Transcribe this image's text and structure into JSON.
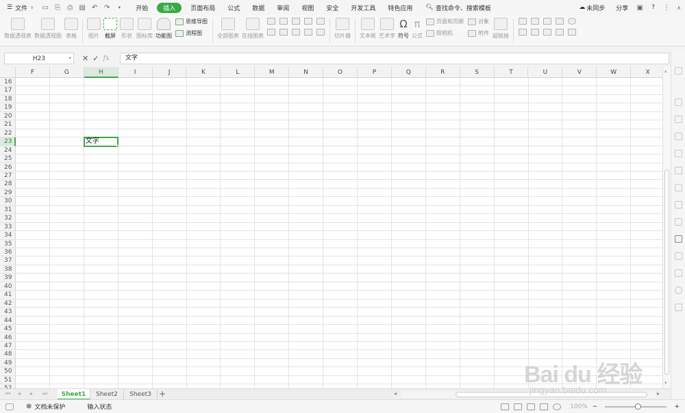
{
  "menu": {
    "file": "文件",
    "tabs": [
      "开始",
      "插入",
      "页面布局",
      "公式",
      "数据",
      "审阅",
      "视图",
      "安全",
      "开发工具",
      "特色应用"
    ],
    "active_tab": "插入",
    "search": "查找命令、搜索模板",
    "sync": "未同步",
    "share": "分享",
    "help": "?"
  },
  "ribbon": {
    "pivot_table": "数据透视表",
    "pivot_chart": "数据透视图",
    "table": "表格",
    "picture": "图片",
    "screenshot": "截屏",
    "shape": "形状",
    "icon_lib": "图标库",
    "func_chart": "功能图",
    "mind_map": "思维导图",
    "flowchart": "流程图",
    "all_charts": "全部图表",
    "online_chart": "在线图表",
    "slicer": "切片器",
    "textbox": "文本框",
    "art_text": "艺术字",
    "symbol": "符号",
    "formula": "公式",
    "header_footer": "页眉和页脚",
    "object": "对象",
    "camera": "照相机",
    "attachment": "附件",
    "hyperlink": "超链接"
  },
  "formula_bar": {
    "cell_ref": "H23",
    "fx": "fx",
    "content": "文字"
  },
  "grid": {
    "columns": [
      "F",
      "G",
      "H",
      "I",
      "J",
      "K",
      "L",
      "M",
      "N",
      "O",
      "P",
      "Q",
      "R",
      "S",
      "T",
      "U",
      "V",
      "W",
      "X"
    ],
    "selected_column": "H",
    "rows": [
      "16",
      "17",
      "18",
      "19",
      "20",
      "21",
      "22",
      "23",
      "24",
      "25",
      "26",
      "27",
      "28",
      "29",
      "30",
      "31",
      "32",
      "33",
      "34",
      "35",
      "36",
      "37",
      "38",
      "39",
      "40",
      "41",
      "42",
      "43",
      "44",
      "45",
      "46",
      "47",
      "48",
      "49",
      "50",
      "51",
      "52"
    ],
    "selected_row": "23",
    "active_cell_value": "文字"
  },
  "sheets": {
    "tabs": [
      "Sheet1",
      "Sheet2",
      "Sheet3"
    ],
    "active": "Sheet1",
    "add": "+"
  },
  "status": {
    "protection": "文档未保护",
    "input_state": "输入状态",
    "zoom": "100%",
    "minus": "−",
    "plus": "+"
  },
  "watermark": {
    "brand": "Bai du 经验",
    "url": "jingyan.baidu.com"
  },
  "colors": {
    "accent": "#3aa845"
  }
}
